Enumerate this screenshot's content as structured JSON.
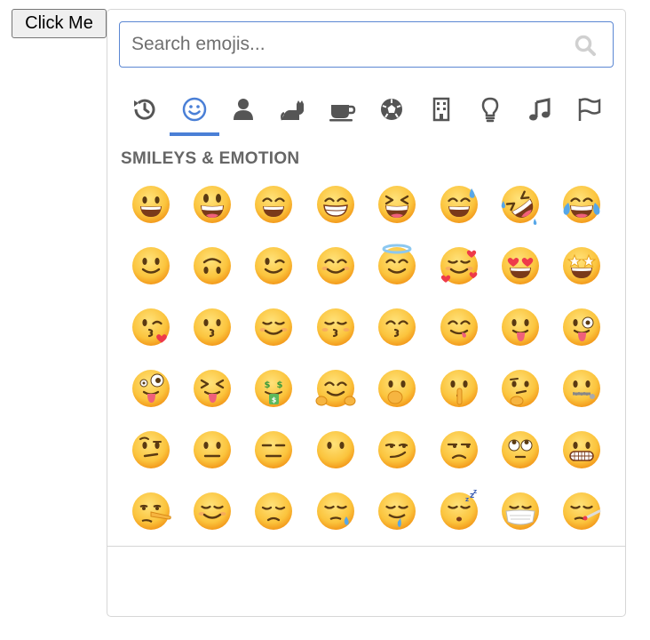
{
  "click_button": {
    "label": "Click Me"
  },
  "search": {
    "placeholder": "Search emojis...",
    "value": ""
  },
  "categories": [
    {
      "name": "recent",
      "icon": "clock-history-icon",
      "active": false
    },
    {
      "name": "smileys",
      "icon": "smiley-icon",
      "active": true
    },
    {
      "name": "people",
      "icon": "person-icon",
      "active": false
    },
    {
      "name": "animals",
      "icon": "cat-icon",
      "active": false
    },
    {
      "name": "food",
      "icon": "coffee-cup-icon",
      "active": false
    },
    {
      "name": "activities",
      "icon": "soccer-ball-icon",
      "active": false
    },
    {
      "name": "travel",
      "icon": "building-icon",
      "active": false
    },
    {
      "name": "objects",
      "icon": "lightbulb-icon",
      "active": false
    },
    {
      "name": "symbols",
      "icon": "music-note-icon",
      "active": false
    },
    {
      "name": "flags",
      "icon": "flag-icon",
      "active": false
    }
  ],
  "colors": {
    "accent": "#4a7fd6",
    "icon_gray": "#555555",
    "border": "#d6d6d6",
    "emoji_face": "#fbc43d"
  },
  "section": {
    "title": "SMILEYS & EMOTION"
  },
  "emojis": [
    "grinning-face",
    "grinning-face-big-eyes",
    "grinning-face-smiling-eyes",
    "beaming-face",
    "grinning-squinting-face",
    "grinning-face-sweat",
    "rolling-on-floor-laughing",
    "tears-of-joy",
    "slightly-smiling-face",
    "upside-down-face",
    "winking-face",
    "smiling-face-smiling-eyes",
    "smiling-face-halo",
    "smiling-face-hearts",
    "heart-eyes",
    "star-struck",
    "face-blowing-kiss",
    "kissing-face",
    "smiling-face",
    "kissing-face-closed-eyes",
    "kissing-face-smiling-eyes",
    "face-savoring-food",
    "face-with-tongue",
    "winking-face-tongue",
    "zany-face",
    "squinting-face-tongue",
    "money-mouth-face",
    "hugging-face",
    "face-hand-over-mouth",
    "shushing-face",
    "thinking-face",
    "zipper-mouth-face",
    "raised-eyebrow-face",
    "neutral-face",
    "expressionless-face",
    "face-without-mouth",
    "smirking-face",
    "unamused-face",
    "face-rolling-eyes",
    "grimacing-face",
    "lying-face",
    "relieved-face",
    "pensive-face",
    "sleepy-face",
    "drooling-face",
    "sleeping-face",
    "face-medical-mask",
    "face-thermometer"
  ]
}
